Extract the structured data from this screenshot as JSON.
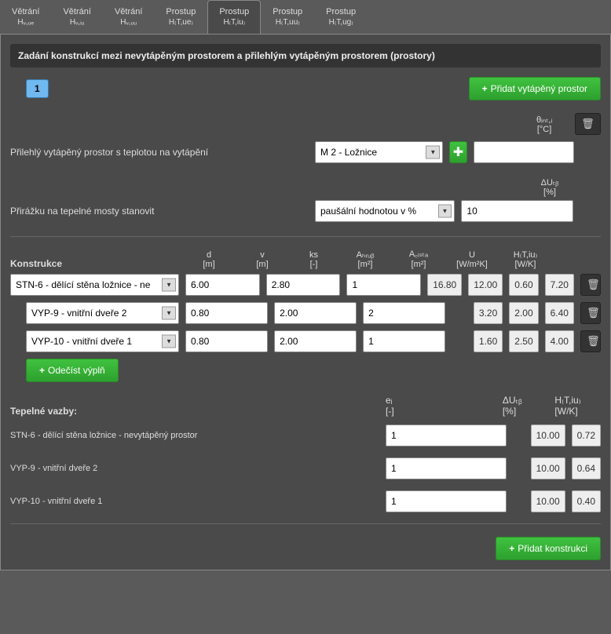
{
  "tabs": [
    {
      "t": "Větrání",
      "s": "Hᵥ,ᵤₑ"
    },
    {
      "t": "Větrání",
      "s": "Hᵥ,ᵢᵤ"
    },
    {
      "t": "Větrání",
      "s": "Hᵥ,ᵤᵤ"
    },
    {
      "t": "Prostup",
      "s": "H₍T,ue₎"
    },
    {
      "t": "Prostup",
      "s": "H₍T,iu₎"
    },
    {
      "t": "Prostup",
      "s": "H₍T,uu₎"
    },
    {
      "t": "Prostup",
      "s": "H₍T,ug₎"
    }
  ],
  "activeTab": 4,
  "sectionTitle": "Zadání konstrukcí mezi nevytápěným prostorem a přilehlým vytápěným prostorem (prostory)",
  "pageBadge": "1",
  "addSpaceBtn": "Přidat vytápěný prostor",
  "thetaHeader": {
    "sym": "θᵢₙₜ,ᵢ",
    "unit": "[°C]"
  },
  "row1": {
    "label": "Přilehlý vytápěný prostor s teplotou na vytápění",
    "option": "M 2 - Ložnice",
    "value": ""
  },
  "row2": {
    "label": "Přirážku na tepelné mosty stanovit",
    "option": "paušální hodnotou v %",
    "header": {
      "sym": "ΔUₜᵦ",
      "unit": "[%]"
    },
    "value": "10"
  },
  "constrHeader": {
    "label": "Konstrukce",
    "cols": [
      {
        "t": "d",
        "u": "[m]"
      },
      {
        "t": "v",
        "u": "[m]"
      },
      {
        "t": "ks",
        "u": "[-]"
      },
      {
        "t": "Aₕᵣᵤᵦ",
        "u": "[m²]"
      },
      {
        "t": "A꜀ᵢₛₜₐ",
        "u": "[m²]"
      },
      {
        "t": "U",
        "u": "[W/m²K]"
      },
      {
        "t": "H₍T,iu₎",
        "u": "[W/K]"
      }
    ]
  },
  "rows": [
    {
      "indent": false,
      "name": "STN-6 - dělící stěna ložnice - ne",
      "d": "6.00",
      "v": "2.80",
      "ks": "1",
      "ahr": "16.80",
      "aci": "12.00",
      "u": "0.60",
      "ht": "7.20"
    },
    {
      "indent": true,
      "name": "VYP-9 - vnitřní dveře 2",
      "d": "0.80",
      "v": "2.00",
      "ks": "2",
      "ahr": "",
      "aci": "3.20",
      "u": "2.00",
      "ht": "6.40"
    },
    {
      "indent": true,
      "name": "VYP-10 - vnitřní dveře 1",
      "d": "0.80",
      "v": "2.00",
      "ks": "1",
      "ahr": "",
      "aci": "1.60",
      "u": "2.50",
      "ht": "4.00"
    }
  ],
  "subtractBtn": "Odečíst výplň",
  "thermal": {
    "label": "Tepelné vazby:",
    "cols": [
      {
        "t": "eᵢ",
        "u": "[-]"
      },
      {
        "t": "ΔUₜᵦ",
        "u": "[%]"
      },
      {
        "t": "H₍T,iu₎",
        "u": "[W/K]"
      }
    ],
    "rows": [
      {
        "name": "STN-6 - dělící stěna ložnice - nevytápěný prostor",
        "e": "1",
        "du": "10.00",
        "ht": "0.72"
      },
      {
        "name": "VYP-9 - vnitřní dveře 2",
        "e": "1",
        "du": "10.00",
        "ht": "0.64"
      },
      {
        "name": "VYP-10 - vnitřní dveře 1",
        "e": "1",
        "du": "10.00",
        "ht": "0.40"
      }
    ]
  },
  "addConstrBtn": "Přidat konstrukci",
  "icons": {
    "plus": "+",
    "trash": "🗑",
    "add": "✚"
  }
}
